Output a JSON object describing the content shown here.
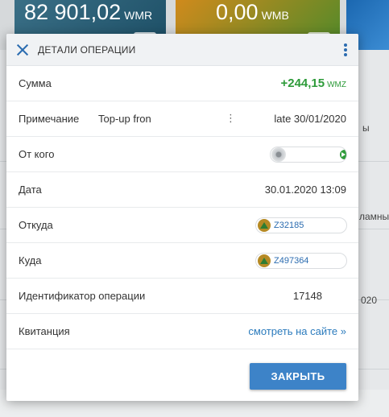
{
  "background": {
    "cards": [
      {
        "amount": "82 901,02",
        "currency": "WMR"
      },
      {
        "amount": "0,00",
        "currency": "WMB"
      }
    ],
    "side_texts": [
      "ы",
      "ламны",
      "020"
    ]
  },
  "dialog": {
    "title": "ДЕТАЛИ ОПЕРАЦИИ",
    "rows": {
      "amount": {
        "label": "Сумма",
        "value": "+244,15",
        "currency": "WMZ"
      },
      "note": {
        "label": "Примечание",
        "text_left": "Top-up fron",
        "dots": "⋮",
        "text_right": "late 30/01/2020"
      },
      "from": {
        "label": "От кого"
      },
      "date": {
        "label": "Дата",
        "value": "30.01.2020 13:09"
      },
      "source": {
        "label": "Откуда",
        "wallet": "Z32185"
      },
      "destination": {
        "label": "Куда",
        "wallet": "Z497364"
      },
      "operation_id": {
        "label": "Идентификатор операции",
        "value": "17148"
      },
      "receipt": {
        "label": "Квитанция",
        "link": "смотреть на сайте »"
      }
    },
    "close_button": "ЗАКРЫТЬ"
  },
  "colors": {
    "accent": "#2b6cb0",
    "positive": "#2e9b3a",
    "button": "#3d83c8"
  }
}
